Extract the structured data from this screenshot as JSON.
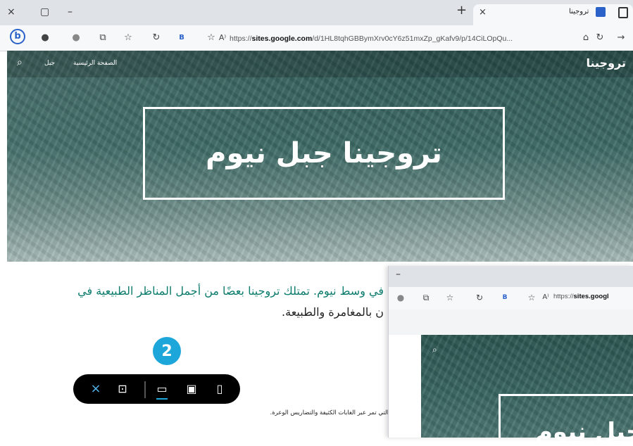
{
  "browser": {
    "tab_title": "تروجينا",
    "url_prefix": "https://",
    "url_domain": "sites.google.com",
    "url_path": "/d/1HL8tqhGBBymXrv0cY6z51mxZp_gKafv9/p/14CiLOpQu...",
    "window_close": "×",
    "window_restore": "▢",
    "window_minimize": "–",
    "new_tab": "+",
    "tab_close": "×",
    "reader_label": "A⁾",
    "bing_label": "b"
  },
  "site": {
    "brand": "تروجينا",
    "nav_home": "الصفحة الرئيسية",
    "nav_mountain": "جبل",
    "hero_title": "تروجينا جبل نيوم"
  },
  "content": {
    "paragraph_line1": "في وسط نيوم. تمتلك تروجينا بعضًا من أجمل المناظر الطبيعية في",
    "paragraph_line2": "ن بالمغامرة والطبيعة.",
    "small_text": "التي تمر عبر الغابات الكثيفة والتضاريس الوعرة."
  },
  "callout": {
    "number": "2"
  },
  "preview_toolbar": {
    "close": "×",
    "icons": [
      "close-icon",
      "comment-icon",
      "desktop-icon",
      "tablet-icon",
      "phone-icon"
    ]
  },
  "overlay": {
    "url_prefix": "https://",
    "url_domain": "sites.googl",
    "hero_title": "جبل نيوم"
  },
  "colors": {
    "accent": "#1da6d9",
    "paragraph": "#0b7b6d",
    "hero": "#3d6a65"
  }
}
